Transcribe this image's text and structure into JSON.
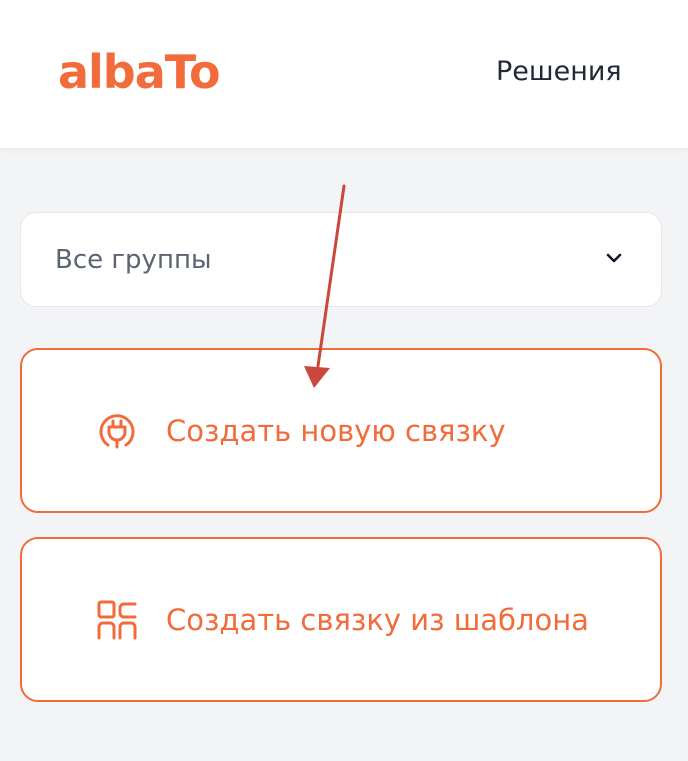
{
  "header": {
    "logo_text": "albaTo",
    "nav_solutions": "Решения"
  },
  "group_filter": {
    "selected": "Все группы",
    "icon": "chevron-down-icon"
  },
  "actions": {
    "create_new": {
      "label": "Создать новую связку",
      "icon": "plug-icon"
    },
    "create_from_template": {
      "label": "Создать связку из шаблона",
      "icon": "template-grid-icon"
    }
  },
  "colors": {
    "brand": "#f26b3a",
    "annotation_arrow": "#c9473b"
  }
}
